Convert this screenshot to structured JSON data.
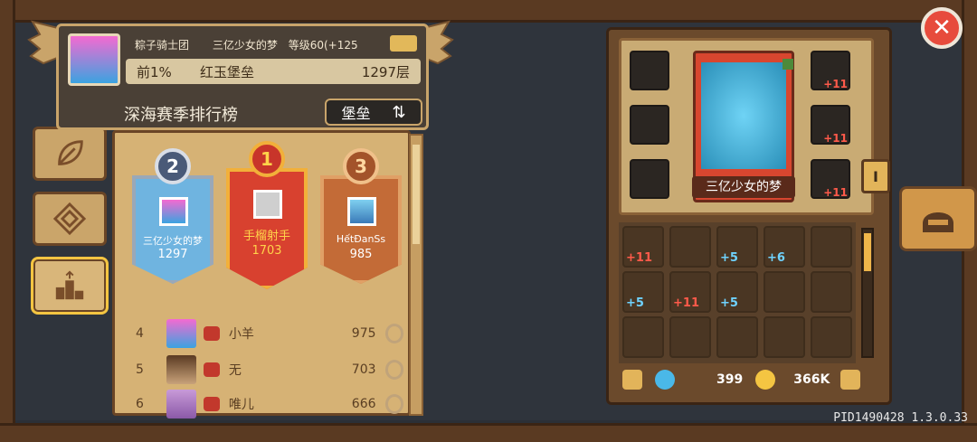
{
  "colors": {
    "gold": "#f4c542",
    "red_banner": "#d8412f",
    "silver_banner": "#6fb4e0",
    "bronze_banner": "#c36b37",
    "panel": "#d6b275"
  },
  "header": {
    "guild": "粽子骑士团",
    "player": "三亿少女的梦",
    "level": "等级60(+125",
    "rank_pct": "前1%",
    "castle": "红玉堡垒",
    "floor": "1297层",
    "title": "深海赛季排行榜",
    "mode": "堡垒"
  },
  "sidebar": [
    {
      "icon": "leaf-icon"
    },
    {
      "icon": "diamond-icon"
    },
    {
      "icon": "podium-icon"
    }
  ],
  "podium": [
    {
      "rank": "2",
      "name": "三亿少女的梦",
      "score": "1297"
    },
    {
      "rank": "1",
      "name": "手榴射手",
      "score": "1703"
    },
    {
      "rank": "3",
      "name": "HếtĐanSs",
      "score": "985"
    }
  ],
  "rows": [
    {
      "rank": "4",
      "name": "小羊",
      "score": "975"
    },
    {
      "rank": "5",
      "name": "无",
      "score": "703"
    },
    {
      "rank": "6",
      "name": "唯儿",
      "score": "666"
    }
  ],
  "hero": {
    "name": "三亿少女的梦",
    "tab": "I"
  },
  "equip_levels": [
    "+11",
    "+11",
    "+11"
  ],
  "inventory": [
    {
      "plus": "+11",
      "color": "#ff5a4a"
    },
    {
      "plus": "",
      "color": "#fff"
    },
    {
      "plus": "+5",
      "color": "#6fd3ff"
    },
    {
      "plus": "+6",
      "color": "#6fd3ff"
    },
    {
      "plus": "+5",
      "color": "#6fd3ff"
    },
    {
      "plus": "+11",
      "color": "#ff5a4a"
    },
    {
      "plus": "+5",
      "color": "#6fd3ff"
    }
  ],
  "resources": {
    "gems": "399",
    "coins": "366K"
  },
  "footer": {
    "pid": "PID1490428 1.3.0.33"
  }
}
